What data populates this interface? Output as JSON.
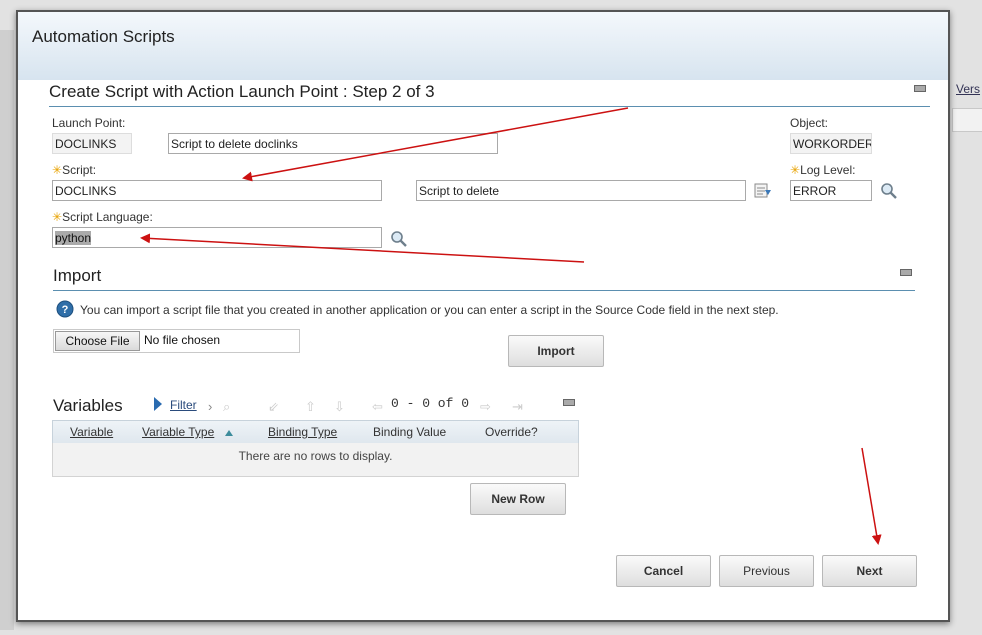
{
  "background": {
    "right_link": "Vers"
  },
  "dialog": {
    "title": "Automation Scripts"
  },
  "step_section": {
    "title": "Create Script with Action Launch Point : Step 2 of 3",
    "launch_point": {
      "label": "Launch Point:",
      "value": "DOCLINKS",
      "description": "Script to delete doclinks"
    },
    "object": {
      "label": "Object:",
      "value": "WORKORDER"
    },
    "script": {
      "label": "Script:",
      "value": "DOCLINKS",
      "description": "Script to delete"
    },
    "log_level": {
      "label": "Log Level:",
      "value": "ERROR"
    },
    "script_language": {
      "label": "Script Language:",
      "value": "python"
    }
  },
  "import_section": {
    "title": "Import",
    "help_text": "You can import a script file that you created in another application or you can enter a script in the Source Code field in the next step.",
    "choose_file_label": "Choose File",
    "no_file_text": "No file chosen",
    "import_button": "Import"
  },
  "variables_section": {
    "title": "Variables",
    "filter_label": "Filter",
    "pager": "0 - 0 of 0",
    "columns": [
      "Variable",
      "Variable Type",
      "Binding Type",
      "Binding Value",
      "Override?"
    ],
    "empty_text": "There are no rows to display.",
    "new_row_button": "New Row"
  },
  "footer": {
    "cancel": "Cancel",
    "previous": "Previous",
    "next": "Next"
  },
  "colors": {
    "annotation_arrow": "#cc1111",
    "section_line": "#5b8fb0",
    "required_star": "#e8a200"
  }
}
